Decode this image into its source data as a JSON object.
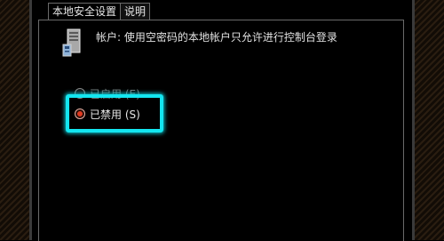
{
  "tabs": [
    {
      "label": "本地安全设置"
    },
    {
      "label": "说明"
    }
  ],
  "policy": {
    "icon": "computer-tower-icon",
    "title": "帐户: 使用空密码的本地帐户只允许进行控制台登录"
  },
  "options": [
    {
      "label": "已启用 (E)",
      "selected": false
    },
    {
      "label": "已禁用 (S)",
      "selected": true
    }
  ],
  "colors": {
    "highlight": "#13e6f0",
    "radio_selected": "#e03a20"
  }
}
